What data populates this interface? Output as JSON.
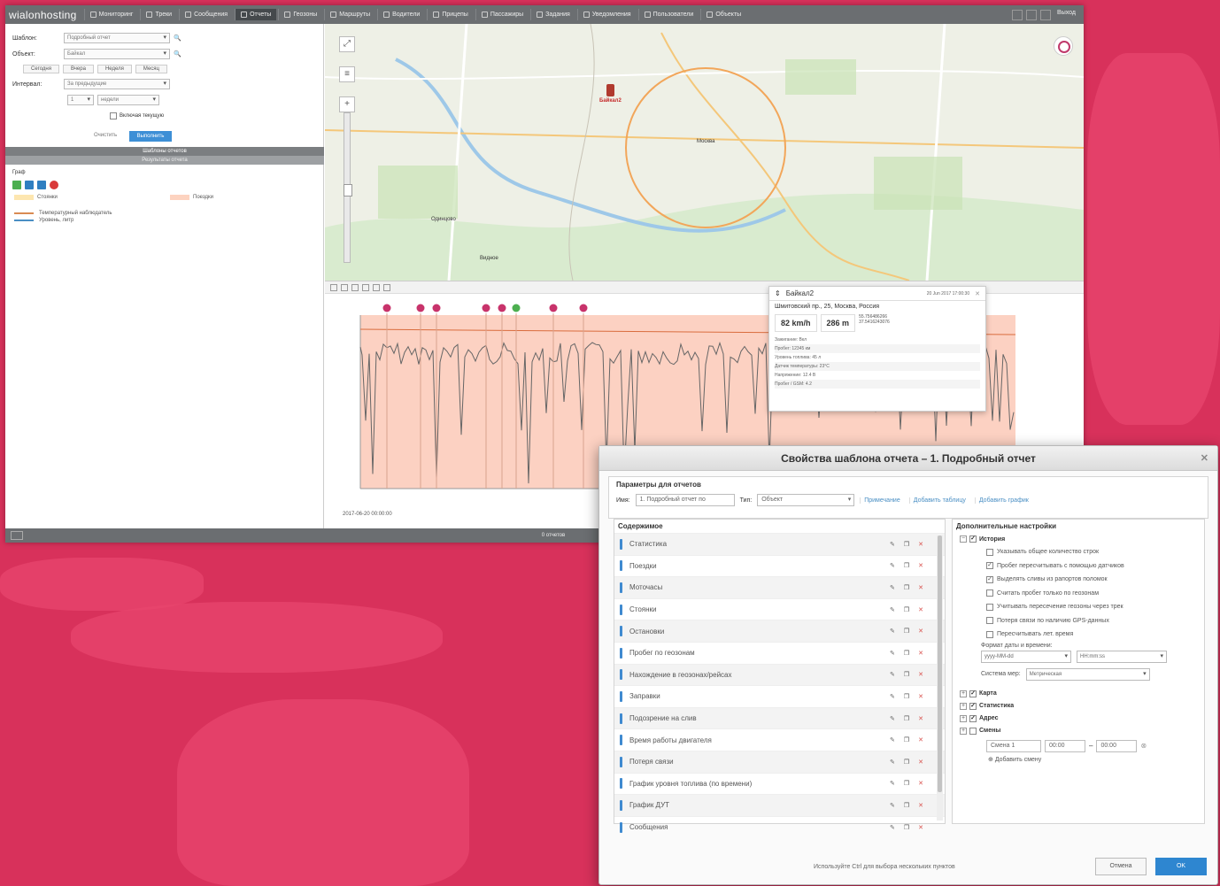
{
  "topnav": {
    "logo": "wialonhosting",
    "items": [
      "Мониторинг",
      "Треки",
      "Сообщения",
      "Отчеты",
      "Геозоны",
      "Маршруты",
      "Водители",
      "Прицепы",
      "Пассажиры",
      "Задания",
      "Уведомления",
      "Пользователи",
      "Объекты"
    ],
    "active_index": 3,
    "user": "Выход"
  },
  "leftpanel": {
    "template_label": "Шаблон:",
    "template_value": "Подробный отчет",
    "object_label": "Объект:",
    "object_value": "Байкал",
    "period_buttons": [
      "Сегодня",
      "Вчера",
      "Неделя",
      "Месяц"
    ],
    "interval_label": "Интервал:",
    "interval_value": "За предыдущие",
    "count_value": "1",
    "unit_value": "недели",
    "current_label": "Включая текущую",
    "clear_label": "Очистить",
    "run_label": "Выполнить",
    "templates_bar": "Шаблоны отчетов",
    "results_bar": "Результаты отчета",
    "chart_label": "Граф",
    "legend_left": "Стоянки",
    "legend_right": "Поездки",
    "series": [
      "Температурный наблюдатель",
      "Уровень, литр"
    ]
  },
  "map": {
    "unit_name": "Байкал2",
    "labels": [
      "Москва",
      "Одинцово",
      "Видное"
    ]
  },
  "chart": {
    "date_label": "2017-06-20 00:00:00"
  },
  "popup": {
    "unit": "Байкал2",
    "date": "20 Jun 2017 17:00:30",
    "address": "Шмитовский пр., 25, Москва, Россия",
    "speed": "82 km/h",
    "altitude": "286 m",
    "lat": "55.756486266",
    "lon": "37.5416243076",
    "rows": [
      "Зажигание: Вкл",
      "Пробег: 12345 км",
      "Уровень топлива: 45 л",
      "Датчик температуры: 23°C",
      "Напряжение: 12.4 В",
      "Пробег / GSM: 4.2"
    ]
  },
  "statusbar": {
    "text": "0 отчетов"
  },
  "dialog": {
    "title": "Свойства шаблона отчета – 1. Подробный отчет",
    "params_title": "Параметры для отчетов",
    "name_label": "Имя:",
    "name_value": "1. Подробный отчет по",
    "type_label": "Тип:",
    "type_value": "Объект",
    "links": [
      "Примечание",
      "Добавить таблицу",
      "Добавить график"
    ],
    "content_title": "Содержимое",
    "rows": [
      "Статистика",
      "Поездки",
      "Моточасы",
      "Стоянки",
      "Остановки",
      "Пробег по геозонам",
      "Нахождение в геозонах/рейсах",
      "Заправки",
      "Подозрение на слив",
      "Время работы двигателя",
      "Потеря связи",
      "График уровня топлива (по времени)",
      "График ДУТ",
      "Сообщения"
    ],
    "settings_title": "Дополнительные настройки",
    "tree_history": "История",
    "options": [
      {
        "label": "Указывать общее количество строк",
        "checked": false
      },
      {
        "label": "Пробег пересчитывать с помощью датчиков",
        "checked": true
      },
      {
        "label": "Выделять сливы из рапортов поломок",
        "checked": true
      },
      {
        "label": "Считать пробег только по геозонам",
        "checked": false
      },
      {
        "label": "Учитывать пересечение геозоны через трек",
        "checked": false
      },
      {
        "label": "Потеря связи по наличию GPS-данных",
        "checked": false
      },
      {
        "label": "Пересчитывать лет. время",
        "checked": false
      }
    ],
    "format_label": "Формат даты и времени:",
    "date_format": "yyyy-MM-dd",
    "time_format": "HH:mm:ss",
    "measure_label": "Система мер:",
    "measure_value": "Метрическая",
    "tree_others": [
      {
        "label": "Карта",
        "checked": true
      },
      {
        "label": "Статистика",
        "checked": true
      },
      {
        "label": "Адрес",
        "checked": true
      },
      {
        "label": "Смены",
        "checked": false
      }
    ],
    "shift_name": "Смена 1",
    "shift_from": "00:00",
    "shift_to": "00:00",
    "add_shift": "Добавить смену",
    "hint": "Используйте Ctrl для выбора нескольких пунктов",
    "cancel": "Отмена",
    "ok": "OK"
  }
}
